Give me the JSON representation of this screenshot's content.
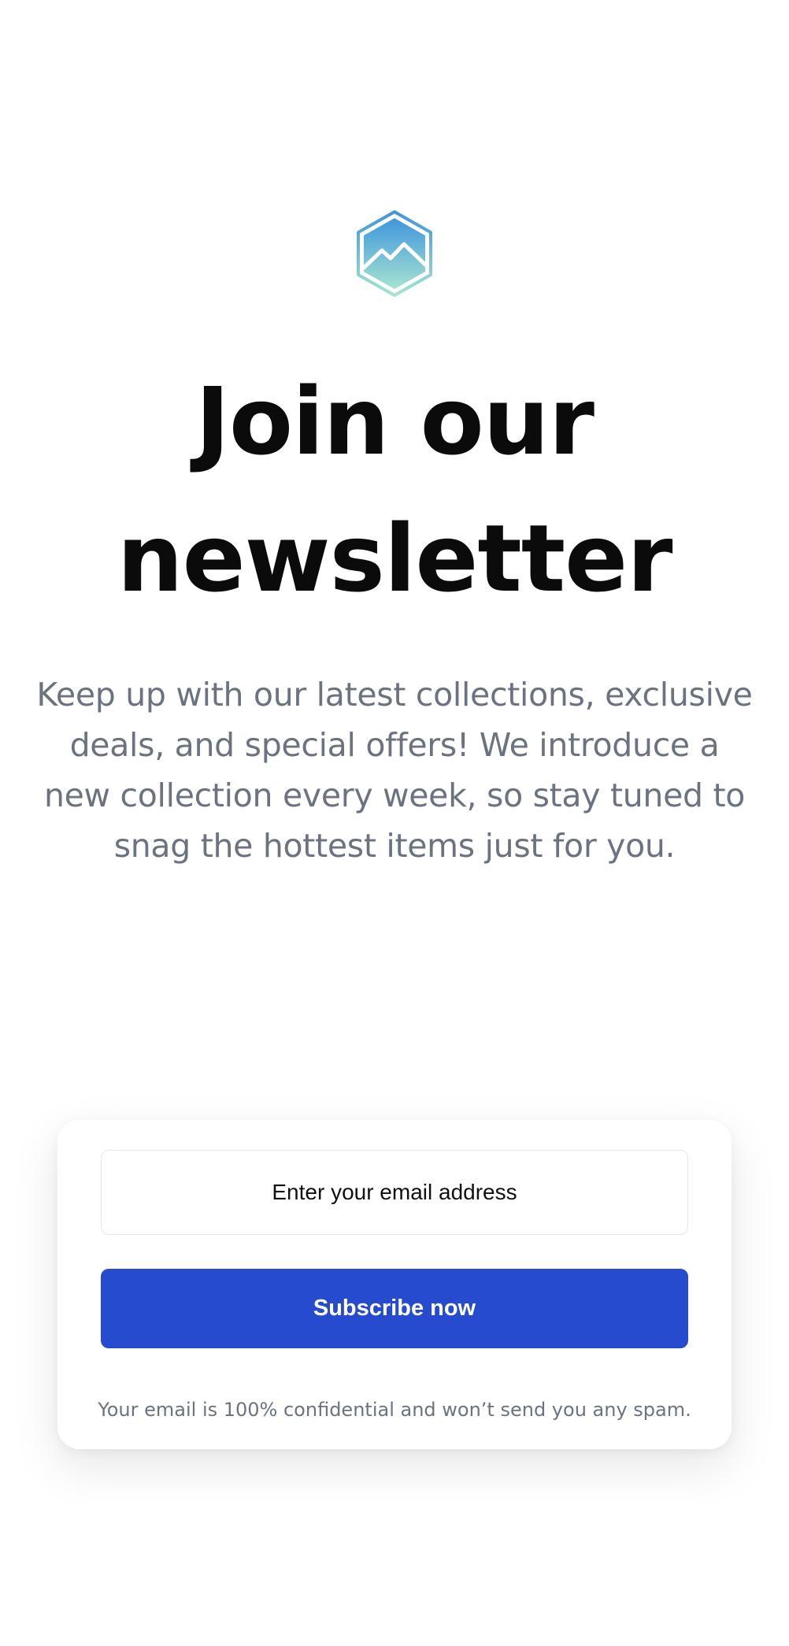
{
  "logo": {
    "icon": "mountain-hexagon-icon",
    "gradient_top": "#4a9fdc",
    "gradient_bottom": "#9ee0d2"
  },
  "hero": {
    "title_line1": "Join our",
    "title_line2": "newsletter",
    "description": "Keep up with our latest collections, exclusive deals, and special offers! We introduce a new collection every week, so stay tuned to snag the hottest items just for you."
  },
  "form": {
    "email_placeholder": "Enter your email address",
    "email_value": "",
    "subscribe_label": "Subscribe now",
    "disclaimer": "Your email is 100% confidential and won’t send you any spam."
  },
  "colors": {
    "primary": "#274bcf",
    "heading": "#0b0b0b",
    "muted_text": "#6b7280"
  }
}
